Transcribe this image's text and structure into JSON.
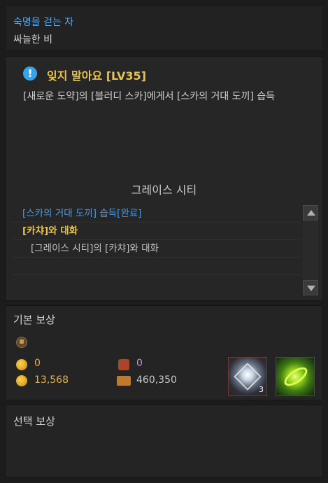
{
  "header": {
    "category": "숙명을 걷는 자",
    "subtitle": "싸늘한 비"
  },
  "quest": {
    "icon": "exclamation-icon",
    "title": "잊지 말아요 [LV35]",
    "description": "[새로운 도약]의 [블러디 스카]에게서 [스카의 거대 도끼] 습득",
    "region": "그레이스 시티",
    "objectives": [
      {
        "text": "[스카의 거대 도끼] 습득[완료]",
        "state": "done"
      },
      {
        "text": "[카챠]와 대화",
        "state": "active"
      },
      {
        "text": "[그레이스 시티]의 [카챠]와 대화",
        "state": "sub"
      }
    ]
  },
  "rewards": {
    "basic_title": "기본 보상",
    "gold_small": "0",
    "bp": "0",
    "gold": "13,568",
    "exp": "460,350",
    "items": [
      {
        "icon": "crystal-item-icon",
        "count": "3"
      },
      {
        "icon": "green-orb-item-icon",
        "count": ""
      }
    ],
    "select_title": "선택 보상"
  },
  "colors": {
    "category": "#5aa7e6",
    "quest_title": "#e7c352",
    "objective_done": "#4c9be0",
    "objective_active": "#e7c352"
  }
}
